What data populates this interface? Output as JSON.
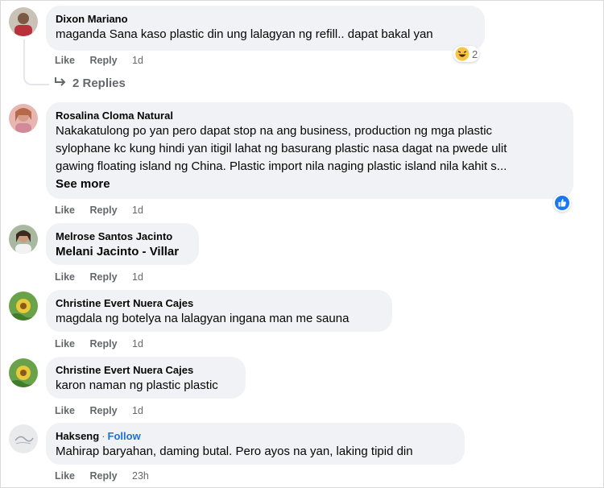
{
  "comments": [
    {
      "author": "Dixon Mariano",
      "text": "maganda Sana kaso plastic din ung lalagyan ng refill.. dapat bakal yan",
      "like": "Like",
      "reply": "Reply",
      "time": "1d",
      "reaction_count": "2"
    },
    {
      "author": "Rosalina Cloma Natural",
      "lines": [
        "Nakakatulong po yan pero dapat stop na ang business, production ng mga plastic",
        "sylophane kc kung hindi yan itigil lahat ng basurang plastic nasa dagat na pwede ulit",
        "gawing floating island ng China. Plastic import nila naging plastic island nila kahit s..."
      ],
      "see_more": "See more",
      "like": "Like",
      "reply": "Reply",
      "time": "1d"
    },
    {
      "author": "Melrose Santos Jacinto",
      "text": "Melani Jacinto - Villar",
      "like": "Like",
      "reply": "Reply",
      "time": "1d"
    },
    {
      "author": "Christine Evert Nuera Cajes",
      "text": "magdala ng botelya na lalagyan ingana man me sauna",
      "like": "Like",
      "reply": "Reply",
      "time": "1d"
    },
    {
      "author": "Christine Evert Nuera Cajes",
      "text": "karon naman ng plastic plastic",
      "like": "Like",
      "reply": "Reply",
      "time": "1d"
    },
    {
      "author": "Hakseng",
      "follow": "Follow",
      "text": "Mahirap baryahan, daming butal. Pero ayos na yan, laking tipid din",
      "like": "Like",
      "reply": "Reply",
      "time": "23h"
    }
  ],
  "replies_label": "2 Replies",
  "colors": {
    "bubble": "#f0f2f5",
    "secondary": "#65676b",
    "link": "#216fdb",
    "like_blue": "#1877f2"
  },
  "icons": {
    "reply_arrow": "reply-arrow-icon",
    "haha": "haha-reaction-icon",
    "like": "like-reaction-icon"
  }
}
